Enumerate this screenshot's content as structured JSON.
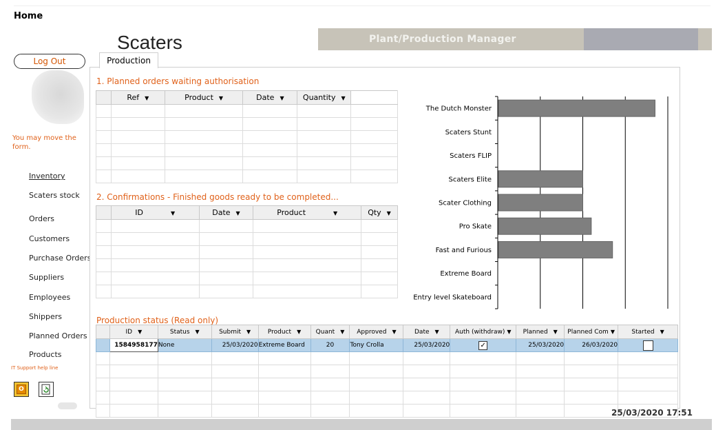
{
  "page": {
    "home_label": "Home"
  },
  "header": {
    "app_title": "Scaters",
    "manager_title": "Plant/Production Manager"
  },
  "sidebar": {
    "logout_label": "Log Out",
    "move_form_note": "You may move the form.",
    "items": [
      {
        "label": "Inventory"
      },
      {
        "label": "Scaters stock"
      },
      {
        "label": "Orders"
      },
      {
        "label": "Customers"
      },
      {
        "label": "Purchase Orders"
      },
      {
        "label": "Suppliers"
      },
      {
        "label": "Employees"
      },
      {
        "label": "Shippers"
      },
      {
        "label": "Planned Orders"
      },
      {
        "label": "Products"
      }
    ],
    "it_support": "IT Support help line",
    "icons": [
      "outlook-icon",
      "refresh-document-icon"
    ]
  },
  "tabs": [
    {
      "label": "Production"
    }
  ],
  "planned_orders": {
    "title": "1. Planned orders waiting authorisation",
    "columns": [
      "Ref",
      "Product",
      "Date",
      "Quantity"
    ],
    "rows": []
  },
  "confirmations": {
    "title": "2. Confirmations - Finished goods ready to be completed...",
    "columns": [
      "ID",
      "Date",
      "Product",
      "Qty"
    ],
    "rows": []
  },
  "production_status": {
    "title": "Production status (Read only)",
    "columns": [
      "ID",
      "Status",
      "Submit",
      "Product",
      "Quant",
      "Approved",
      "Date",
      "Auth (withdraw)",
      "Planned",
      "Planned Com",
      "Started"
    ],
    "rows": [
      {
        "id": "1584958177",
        "status": "None",
        "submit": "25/03/2020",
        "product": "Extreme Board",
        "quant": "20",
        "approved": "Tony Crolla",
        "date": "25/03/2020",
        "auth_withdraw": true,
        "planned": "25/03/2020",
        "planned_com": "26/03/2020",
        "started": false
      }
    ]
  },
  "chart_data": {
    "type": "bar",
    "orientation": "horizontal",
    "categories": [
      "The Dutch Monster",
      "Scaters Stunt",
      "Scaters FLIP",
      "Scaters Elite",
      "Scater Clothing",
      "Pro Skate",
      "Fast and Furious",
      "Extreme Board",
      "Entry level Skateboard"
    ],
    "values": [
      3.7,
      0,
      0,
      2,
      2,
      2.2,
      2.7,
      0,
      0
    ],
    "xlim": [
      0,
      4
    ],
    "grid": true,
    "bar_color": "#7f7f7f"
  },
  "status_bar": {
    "datetime": "25/03/2020 17:51"
  },
  "colors": {
    "accent": "#e0611a",
    "manager_bar": "#c7c3b8",
    "selection": "#b7d3ea"
  }
}
